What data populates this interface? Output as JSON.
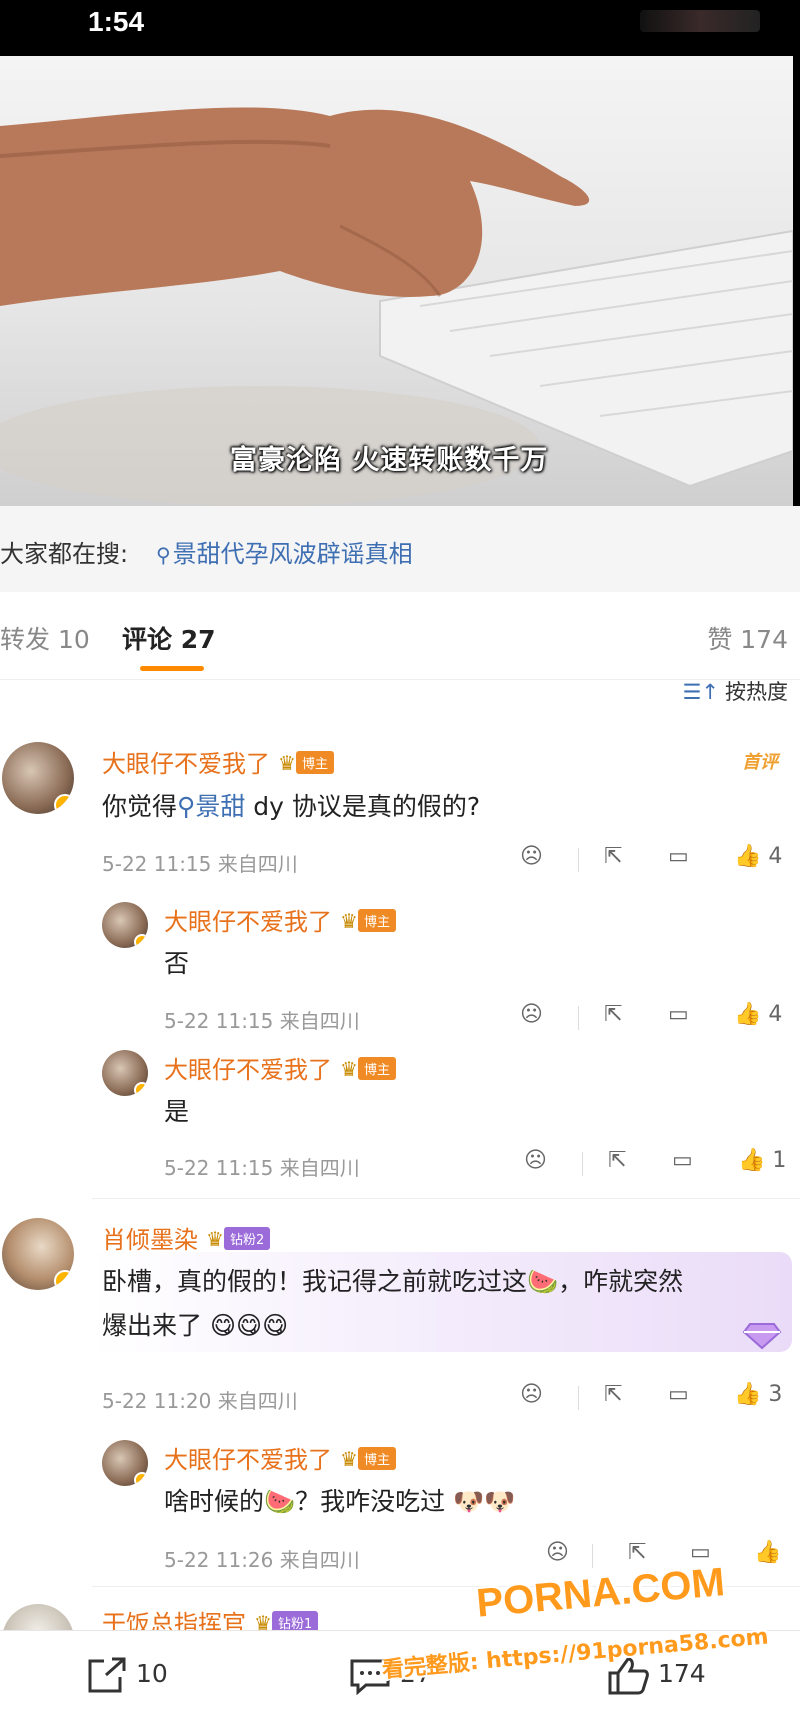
{
  "status_bar": {
    "time": "1:54"
  },
  "video": {
    "caption": "富豪沦陷 火速转账数千万"
  },
  "search": {
    "prefix": "大家都在搜:",
    "icon": "search-icon",
    "query": "景甜代孕风波辟谣真相"
  },
  "tabs": {
    "repost": "转发 10",
    "comments": "评论 27",
    "likes": "赞 174"
  },
  "sort": {
    "icon": "sort-icon",
    "label": "按热度"
  },
  "comments": [
    {
      "name": "大眼仔不爱我了",
      "badge": "博主",
      "tag": "首评",
      "text_pre": "你觉得",
      "text_link": "景甜",
      "text_post": "dy 协议是真的假的?",
      "meta": "5-22 11:15 来自四川",
      "likes": "4"
    },
    {
      "name": "大眼仔不爱我了",
      "badge": "博主",
      "text": "否",
      "meta": "5-22 11:15 来自四川",
      "likes": "4"
    },
    {
      "name": "大眼仔不爱我了",
      "badge": "博主",
      "text": "是",
      "meta": "5-22 11:15 来自四川",
      "likes": "1"
    },
    {
      "name": "肖倾墨染",
      "badge": "钻粉2",
      "text_line1_a": "卧槽，真的假的！我记得之前就吃过这",
      "text_line1_b": "，咋就突然",
      "text_line2": "爆出来了",
      "meta": "5-22 11:20 来自四川",
      "likes": "3"
    },
    {
      "name": "大眼仔不爱我了",
      "badge": "博主",
      "text_a": "啥时候的",
      "text_b": "？我咋没吃过",
      "meta": "5-22 11:26 来自四川",
      "likes": ""
    },
    {
      "name": "干饭总指挥官",
      "badge": "钻粉1"
    }
  ],
  "bottom_bar": {
    "repost_count": "10",
    "comment_count": "27",
    "like_count": "174"
  },
  "watermark": {
    "brand": "PORNA.COM",
    "url": "看完整版: https://91porna58.com"
  },
  "colors": {
    "name": "#e8711b",
    "link": "#3f6fb3",
    "accent": "#ff8a00",
    "watermark": "#ff9a1c"
  }
}
